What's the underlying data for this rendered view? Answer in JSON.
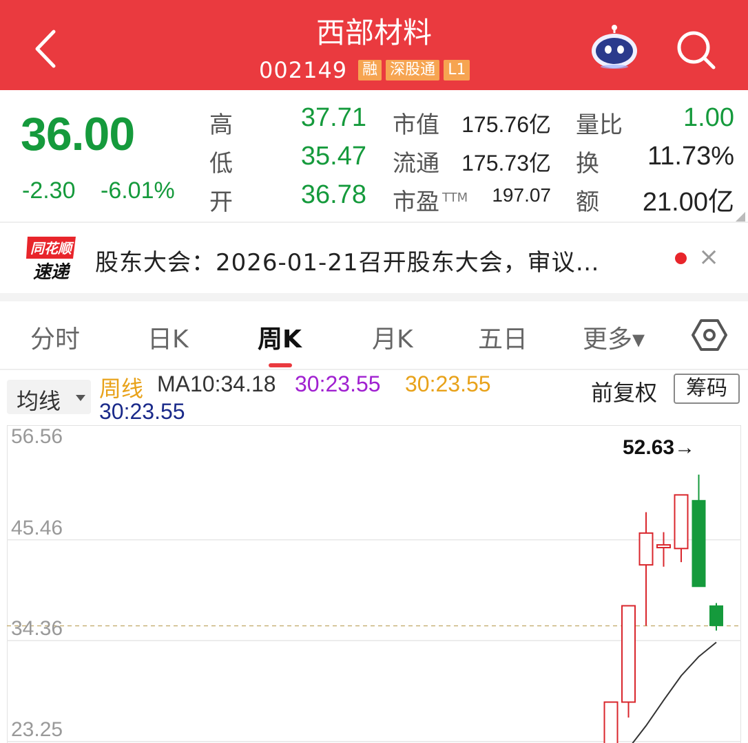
{
  "header": {
    "title": "西部材料",
    "code": "002149",
    "tags": [
      "融",
      "深股通",
      "L1"
    ],
    "bg_color": "#ea3a3f"
  },
  "icons": {
    "back": "back-chevron-icon",
    "assistant": "robot-assistant-icon",
    "search": "search-icon",
    "settings": "hexagon-settings-icon",
    "dropdown": "caret-down-icon",
    "close": "close-icon"
  },
  "quote": {
    "price": "36.00",
    "change": "-2.30",
    "change_pct": "-6.01%",
    "down_color": "#159a3c",
    "up_color": "#d9262c",
    "stats": {
      "high_label": "高",
      "high": "37.71",
      "low_label": "低",
      "low": "35.47",
      "open_label": "开",
      "open": "36.78",
      "mcap_label": "市值",
      "mcap": "175.76亿",
      "float_label": "流通",
      "float": "175.73亿",
      "pe_label": "市盈",
      "pe_sup": "TTM",
      "pe": "197.07",
      "vol_ratio_label": "量比",
      "vol_ratio": "1.00",
      "turnover_label": "换",
      "turnover": "11.73%",
      "amount_label": "额",
      "amount": "21.00亿"
    }
  },
  "news": {
    "logo_top": "同花顺",
    "logo_bottom": "速递",
    "text": "股东大会：2026-01-21召开股东大会，审议…",
    "close": "×"
  },
  "tabs": [
    {
      "label": "分时"
    },
    {
      "label": "日K"
    },
    {
      "label": "周K",
      "active": true
    },
    {
      "label": "月K"
    },
    {
      "label": "五日"
    },
    {
      "label": "更多▾"
    }
  ],
  "ma_bar": {
    "button": "均线",
    "period": "周线",
    "ma10": "MA10:34.18",
    "ma30_a": "30:23.55",
    "ma30_b": "30:23.55",
    "ma30_c": "30:23.55",
    "colors": {
      "period": "#e8a21a",
      "ma10": "#333333",
      "ma30_a": "#a020d0",
      "ma30_b": "#e8a21a",
      "ma30_c": "#1a2a8a"
    },
    "adjust": "前复权",
    "chips": "筹码"
  },
  "chart_data": {
    "type": "candlestick",
    "y_ticks": [
      "56.56",
      "45.46",
      "34.36",
      "23.25"
    ],
    "ylim": [
      23.25,
      56.56
    ],
    "max_marker": "52.63→",
    "current_price_line": 36.0,
    "candles": [
      {
        "open": 27.6,
        "close": 20.5,
        "high": 27.6,
        "low": 19.0,
        "dir": "up"
      },
      {
        "open": 27.6,
        "close": 38.2,
        "high": 38.2,
        "low": 25.9,
        "dir": "up"
      },
      {
        "open": 42.7,
        "close": 46.2,
        "high": 48.5,
        "low": 36.0,
        "dir": "up"
      },
      {
        "open": 44.6,
        "close": 44.9,
        "high": 46.3,
        "low": 42.5,
        "dir": "up"
      },
      {
        "open": 44.5,
        "close": 50.4,
        "high": 50.4,
        "low": 43.0,
        "dir": "up"
      },
      {
        "open": 49.8,
        "close": 40.3,
        "high": 52.63,
        "low": 40.3,
        "dir": "down"
      },
      {
        "open": 38.2,
        "close": 36.0,
        "high": 38.5,
        "low": 35.47,
        "dir": "down"
      }
    ],
    "ma_line": [
      22.5,
      25.0,
      27.8,
      30.5,
      32.6,
      34.18
    ]
  }
}
